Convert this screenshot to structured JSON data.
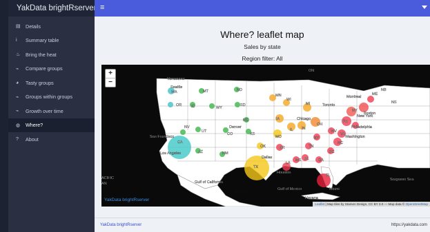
{
  "app": {
    "brand": "YakData brightRserver"
  },
  "sidebar": {
    "items": [
      {
        "icon": "table-icon",
        "glyph": "▤",
        "label": "Details"
      },
      {
        "icon": "info-icon",
        "glyph": "i",
        "label": "Summary table"
      },
      {
        "icon": "fire-icon",
        "glyph": "♨",
        "label": "Bring the heat"
      },
      {
        "icon": "line-chart-icon",
        "glyph": "⌁",
        "label": "Compare groups"
      },
      {
        "icon": "cookie-icon",
        "glyph": "◕",
        "label": "Tasty groups"
      },
      {
        "icon": "line-chart-icon",
        "glyph": "⌁",
        "label": "Groups within groups"
      },
      {
        "icon": "line-chart-icon",
        "glyph": "⌁",
        "label": "Growth over time"
      },
      {
        "icon": "globe-icon",
        "glyph": "◍",
        "label": "Where?"
      },
      {
        "icon": "question-icon",
        "glyph": "?",
        "label": "About"
      }
    ],
    "active_index": 7
  },
  "topbar": {
    "menu_icon": "hamburger-icon",
    "menu_glyph": "≡"
  },
  "page": {
    "title": "Where? leaflet map",
    "subtitle": "Sales by state",
    "filter": "Region filter: All"
  },
  "map": {
    "zoom_in": "+",
    "zoom_out": "−",
    "brand": "YakData brightRserver",
    "credit_leaflet": "Leaflet",
    "credit_text": " | Map tiles by Stamen Design, CC BY 3.0 — Map data © ",
    "credit_osm": "OpenStreetMap",
    "labels": [
      {
        "text": "Vancouver",
        "color": "#ffffff"
      },
      {
        "text": "Seattle",
        "color": "#ffffff"
      },
      {
        "text": "WA",
        "color": "#ffffff"
      },
      {
        "text": "MT",
        "color": "#ffffff"
      },
      {
        "text": "ND",
        "color": "#ffffff"
      },
      {
        "text": "OR",
        "color": "#ffffff"
      },
      {
        "text": "ID",
        "color": "#ffffff"
      },
      {
        "text": "SD",
        "color": "#ffffff"
      },
      {
        "text": "WY",
        "color": "#ffffff"
      },
      {
        "text": "MN",
        "color": "#ffffff"
      },
      {
        "text": "ON",
        "color": "#ffffff"
      },
      {
        "text": "WI",
        "color": "#ffffff"
      },
      {
        "text": "MI",
        "color": "#ffffff"
      },
      {
        "text": "NE",
        "color": "#ffffff"
      },
      {
        "text": "IA",
        "color": "#ffffff"
      },
      {
        "text": "Chicago",
        "color": "#ffffff"
      },
      {
        "text": "NV",
        "color": "#ffffff"
      },
      {
        "text": "UT",
        "color": "#ffffff"
      },
      {
        "text": "Denver",
        "color": "#ffffff"
      },
      {
        "text": "CO",
        "color": "#ffffff"
      },
      {
        "text": "KS",
        "color": "#ffffff"
      },
      {
        "text": "MO",
        "color": "#ffffff"
      },
      {
        "text": "IL",
        "color": "#ffffff"
      },
      {
        "text": "IN",
        "color": "#ffffff"
      },
      {
        "text": "OH",
        "color": "#ffffff"
      },
      {
        "text": "San Francisco",
        "color": "#ffffff"
      },
      {
        "text": "CA",
        "color": "#ffffff"
      },
      {
        "text": "Los Angeles",
        "color": "#ffffff"
      },
      {
        "text": "AZ",
        "color": "#ffffff"
      },
      {
        "text": "NM",
        "color": "#ffffff"
      },
      {
        "text": "OK",
        "color": "#ffffff"
      },
      {
        "text": "AR",
        "color": "#ffffff"
      },
      {
        "text": "TN",
        "color": "#ffffff"
      },
      {
        "text": "KY",
        "color": "#ffffff"
      },
      {
        "text": "WV",
        "color": "#ffffff"
      },
      {
        "text": "VA",
        "color": "#ffffff"
      },
      {
        "text": "NC",
        "color": "#ffffff"
      },
      {
        "text": "SC",
        "color": "#ffffff"
      },
      {
        "text": "GA",
        "color": "#ffffff"
      },
      {
        "text": "AL",
        "color": "#ffffff"
      },
      {
        "text": "MS",
        "color": "#ffffff"
      },
      {
        "text": "LA",
        "color": "#ffffff"
      },
      {
        "text": "TX",
        "color": "#ffffff"
      },
      {
        "text": "Dallas",
        "color": "#ffffff"
      },
      {
        "text": "Houston",
        "color": "#ffffff"
      },
      {
        "text": "FL",
        "color": "#ffffff"
      },
      {
        "text": "Miami",
        "color": "#ffffff"
      },
      {
        "text": "Havana",
        "color": "#ffffff"
      },
      {
        "text": "Montreal",
        "color": "#ffffff"
      },
      {
        "text": "Toronto",
        "color": "#ffffff"
      },
      {
        "text": "NY",
        "color": "#ffffff"
      },
      {
        "text": "New York",
        "color": "#ffffff"
      },
      {
        "text": "Boston",
        "color": "#ffffff"
      },
      {
        "text": "Philadelphia",
        "color": "#ffffff"
      },
      {
        "text": "Washington",
        "color": "#ffffff"
      },
      {
        "text": "PA",
        "color": "#ffffff"
      },
      {
        "text": "ME",
        "color": "#ffffff"
      },
      {
        "text": "NB",
        "color": "#ffffff"
      },
      {
        "text": "NS",
        "color": "#ffffff"
      },
      {
        "text": "Gulf of California",
        "color": "#ffffff"
      },
      {
        "text": "Mexico",
        "color": "#111111"
      },
      {
        "text": "Gulf of Mexico",
        "color": "#ffffff"
      },
      {
        "text": "Sargasso Sea",
        "color": "#ffffff"
      },
      {
        "text": "ACIFIC",
        "color": "#ffffff"
      },
      {
        "text": "AN",
        "color": "#ffffff"
      }
    ],
    "markers": [
      {
        "state": "WA",
        "color": "#40c0c8"
      },
      {
        "state": "OR",
        "color": "#40c0c8"
      },
      {
        "state": "MT",
        "color": "#3cb54a"
      },
      {
        "state": "ND",
        "color": "#3cb54a"
      },
      {
        "state": "SD",
        "color": "#3cb54a"
      },
      {
        "state": "WY",
        "color": "#3cb54a"
      },
      {
        "state": "NE",
        "color": "#3cb54a"
      },
      {
        "state": "ID",
        "color": "#3cb54a"
      },
      {
        "state": "NV",
        "color": "#3cb54a"
      },
      {
        "state": "UT",
        "color": "#3cb54a"
      },
      {
        "state": "CO",
        "color": "#3cb54a"
      },
      {
        "state": "KS",
        "color": "#3cb54a"
      },
      {
        "state": "AZ",
        "color": "#3cb54a"
      },
      {
        "state": "NM",
        "color": "#3cb54a"
      },
      {
        "state": "CA",
        "color": "#40c8c8"
      },
      {
        "state": "TX",
        "color": "#f5c518"
      },
      {
        "state": "MN",
        "color": "#f5a623"
      },
      {
        "state": "WI",
        "color": "#f5a623"
      },
      {
        "state": "MI",
        "color": "#f5a623"
      },
      {
        "state": "IA",
        "color": "#f5a623"
      },
      {
        "state": "IL",
        "color": "#f5a623"
      },
      {
        "state": "IN",
        "color": "#f5a623"
      },
      {
        "state": "OH",
        "color": "#f28a30"
      },
      {
        "state": "MO",
        "color": "#f5c518"
      },
      {
        "state": "OK",
        "color": "#f5c518"
      },
      {
        "state": "AR",
        "color": "#f03c50"
      },
      {
        "state": "LA",
        "color": "#f03c50"
      },
      {
        "state": "MS",
        "color": "#f03c50"
      },
      {
        "state": "AL",
        "color": "#f03c50"
      },
      {
        "state": "TN",
        "color": "#f03c50"
      },
      {
        "state": "KY",
        "color": "#f03c50"
      },
      {
        "state": "GA",
        "color": "#f03c50"
      },
      {
        "state": "FL",
        "color": "#e8203c"
      },
      {
        "state": "SC",
        "color": "#f03c50"
      },
      {
        "state": "NC",
        "color": "#f03c50"
      },
      {
        "state": "VA",
        "color": "#f03c50"
      },
      {
        "state": "WV",
        "color": "#f03c50"
      },
      {
        "state": "PA",
        "color": "#f03c50"
      },
      {
        "state": "NY",
        "color": "#f05a50"
      },
      {
        "state": "NJ",
        "color": "#f03c50"
      },
      {
        "state": "MA",
        "color": "#f05050"
      },
      {
        "state": "ME",
        "color": "#f03c50"
      }
    ]
  },
  "footer": {
    "left": "YakData brightRserver",
    "right": "https://yakdata.com"
  }
}
